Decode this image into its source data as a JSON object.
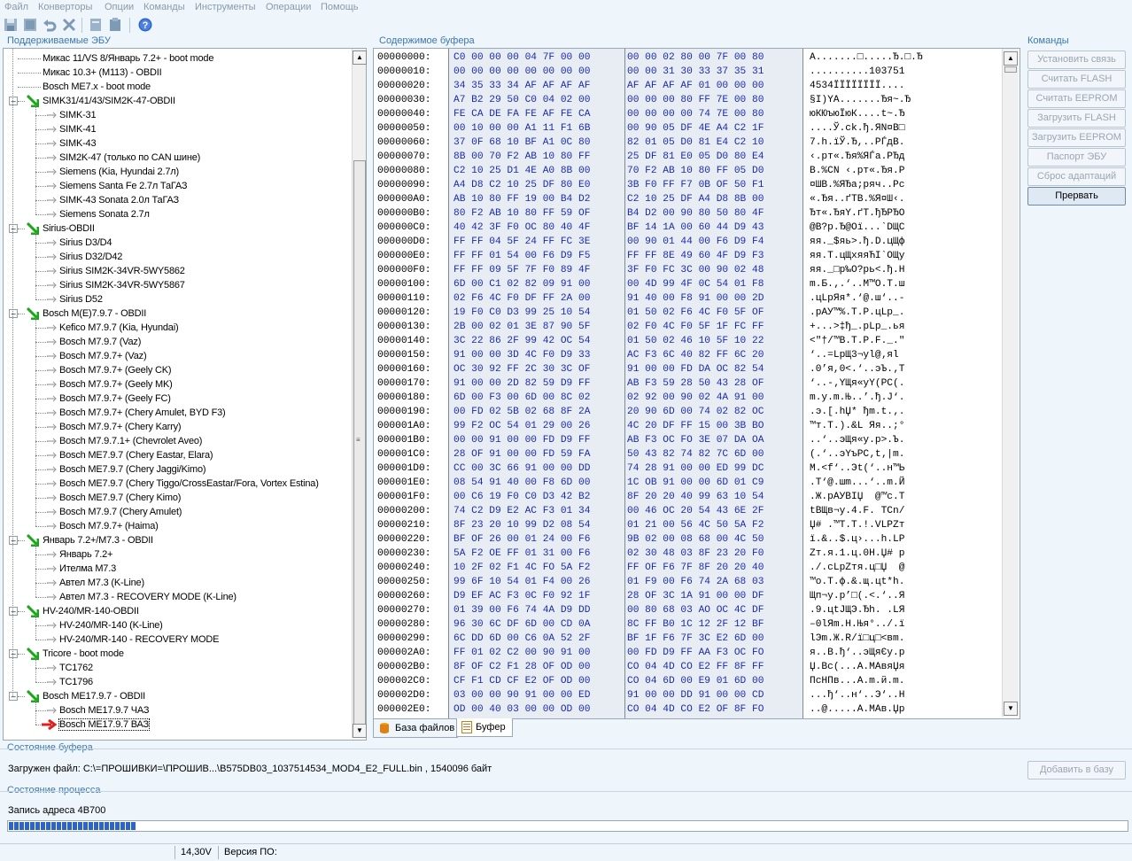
{
  "menu": [
    "Файл",
    "Конверторы",
    "Опции",
    "Команды",
    "Инструменты",
    "Операции",
    "Помощь"
  ],
  "toolbar_icons": [
    "save-icon",
    "save-all-icon",
    "undo-icon",
    "tools-icon",
    "copy-icon",
    "paste-icon",
    "help-icon"
  ],
  "sections": {
    "ecu": "Поддерживаемые ЭБУ",
    "buffer": "Содержимое буфера",
    "commands": "Команды",
    "buffer_state": "Состояние буфера",
    "process_state": "Состояние процесса"
  },
  "tree": [
    {
      "label": "Микас 11/VS 8/Январь 7.2+ - boot mode",
      "level": 1
    },
    {
      "label": "Микас 10.3+ (M113) - OBDII",
      "level": 1
    },
    {
      "label": "Bosch ME7.x - boot mode",
      "level": 1
    },
    {
      "label": "SIMK31/41/43/SIM2K-47-OBDII",
      "level": 0
    },
    {
      "label": "SIMK-31",
      "level": 2
    },
    {
      "label": "SIMK-41",
      "level": 2
    },
    {
      "label": "SIMK-43",
      "level": 2
    },
    {
      "label": "SIM2K-47 (только по CAN шине)",
      "level": 2
    },
    {
      "label": "Siemens (Kia, Hyundai 2.7л)",
      "level": 2
    },
    {
      "label": "Siemens Santa Fe 2.7л ТаГАЗ",
      "level": 2
    },
    {
      "label": "SIMK-43 Sonata 2.0л ТаГАЗ",
      "level": 2
    },
    {
      "label": "Siemens Sonata 2.7л",
      "level": 2
    },
    {
      "label": "Sirius-OBDII",
      "level": 0
    },
    {
      "label": "Sirius D3/D4",
      "level": 2
    },
    {
      "label": "Sirius D32/D42",
      "level": 2
    },
    {
      "label": "Sirius SIM2K-34VR-5WY5862",
      "level": 2
    },
    {
      "label": "Sirius SIM2K-34VR-5WY5867",
      "level": 2
    },
    {
      "label": "Sirius D52",
      "level": 2
    },
    {
      "label": "Bosch M(E)7.9.7 - OBDII",
      "level": 0
    },
    {
      "label": "Kefico M7.9.7 (Kia, Hyundai)",
      "level": 2
    },
    {
      "label": "Bosch M7.9.7 (Vaz)",
      "level": 2
    },
    {
      "label": "Bosch M7.9.7+ (Vaz)",
      "level": 2
    },
    {
      "label": "Bosch M7.9.7+ (Geely CK)",
      "level": 2
    },
    {
      "label": "Bosch M7.9.7+ (Geely MK)",
      "level": 2
    },
    {
      "label": "Bosch M7.9.7+ (Geely FC)",
      "level": 2
    },
    {
      "label": "Bosch M7.9.7+ (Chery Amulet, BYD F3)",
      "level": 2
    },
    {
      "label": "Bosch M7.9.7+ (Chery Karry)",
      "level": 2
    },
    {
      "label": "Bosch M7.9.7.1+ (Chevrolet Aveo)",
      "level": 2
    },
    {
      "label": "Bosch ME7.9.7 (Chery Eastar, Elara)",
      "level": 2
    },
    {
      "label": "Bosch ME7.9.7 (Chery Jaggi/Kimo)",
      "level": 2
    },
    {
      "label": "Bosch ME7.9.7 (Chery Tiggo/CrossEastar/Fora, Vortex Estina)",
      "level": 2
    },
    {
      "label": "Bosch ME7.9.7 (Chery Kimo)",
      "level": 2
    },
    {
      "label": "Bosch M7.9.7 (Chery Amulet)",
      "level": 2
    },
    {
      "label": "Bosch M7.9.7+ (Haima)",
      "level": 2
    },
    {
      "label": "Январь 7.2+/M7.3 - OBDII",
      "level": 0
    },
    {
      "label": "Январь 7.2+",
      "level": 2
    },
    {
      "label": "Ителма M7.3",
      "level": 2
    },
    {
      "label": "Автел M7.3  (K-Line)",
      "level": 2
    },
    {
      "label": "Автел M7.3 - RECOVERY MODE  (K-Line)",
      "level": 2
    },
    {
      "label": "HV-240/MR-140-OBDII",
      "level": 0
    },
    {
      "label": "HV-240/MR-140 (K-Line)",
      "level": 2
    },
    {
      "label": "HV-240/MR-140 - RECOVERY MODE",
      "level": 2
    },
    {
      "label": "Tricore - boot mode",
      "level": 0
    },
    {
      "label": "TC1762",
      "level": 2
    },
    {
      "label": "TC1796",
      "level": 2
    },
    {
      "label": "Bosch ME17.9.7 - OBDII",
      "level": 0
    },
    {
      "label": "Bosch ME17.9.7 ЧАЗ",
      "level": 2
    },
    {
      "label": "Bosch ME17.9.7 ВАЗ",
      "level": 2,
      "selected": true
    }
  ],
  "hex_rows": [
    [
      "00000000:",
      "C0 00 00 00 04 7F 00 00",
      "00 00 02 80 00 7F 00 80",
      "А.......□.....Ђ.□.Ђ"
    ],
    [
      "00000010:",
      "00 00 00 00 00 00 00 00",
      "00 00 31 30 33 37 35 31",
      "..........103751"
    ],
    [
      "00000020:",
      "34 35 33 34 AF AF AF AF",
      "AF AF AF AF 01 00 00 00",
      "4534ЇЇЇЇЇЇЇЇ...."
    ],
    [
      "00000030:",
      "A7 B2 29 50 C0 04 02 00",
      "00 00 00 80 FF 7E 00 80",
      "§І)YА.......Ђя~.Ђ"
    ],
    [
      "00000040:",
      "FE CA DE FA FE AF FE CA",
      "00 00 00 00 74 7E 00 80",
      "юКЮъюЇюК....t~.Ђ"
    ],
    [
      "00000050:",
      "00 10 00 00 A1 11 F1 6B",
      "00 90 05 DF 4E A4 C2 1F",
      "....Ў.ck.ђ.ЯN¤В□"
    ],
    [
      "00000060:",
      "37 0F 68 10 BF A1 0C 80",
      "82 01 05 D0 81 E4 C2 10",
      "7.h.їЎ.Ђ,..РЃдВ."
    ],
    [
      "00000070:",
      "8B 00 70 F2 AB 10 80 FF",
      "25 DF 81 E0 05 D0 80 E4",
      "‹.рт«.Ђя%ЯЃа.РЂд"
    ],
    [
      "00000080:",
      "C2 10 25 D1 4E A0 8B 00",
      "70 F2 AB 10 80 FF 05 D0",
      "В.%СN ‹.рт«.Ђя.Р"
    ],
    [
      "00000090:",
      "A4 D8 C2 10 25 DF 80 E0",
      "3B F0 FF F7 0B OF 50 F1",
      "¤ШВ.%ЯЂа;ряч..Pс"
    ],
    [
      "000000A0:",
      "AB 10 80 FF 19 00 B4 D2",
      "C2 10 25 DF A4 D8 8B 00",
      "«.Ђя..ґТВ.%Я¤Ш‹."
    ],
    [
      "000000B0:",
      "80 F2 AB 10 80 FF 59 OF",
      "B4 D2 00 90 80 50 80 4F",
      "Ђт«.ЂяY.ґТ.ђЂPЂO"
    ],
    [
      "000000C0:",
      "40 42 3F F0 OC 80 40 4F",
      "BF 14 1A 00 60 44 D9 43",
      "@B?р.Ђ@Oї...`DЩC"
    ],
    [
      "000000D0:",
      "FF FF 04 5F 24 FF FC 3E",
      "00 90 01 44 00 F6 D9 F4",
      "яя._$яь>.ђ.D.цЩф"
    ],
    [
      "000000E0:",
      "FF FF 01 54 00 F6 D9 F5",
      "FF FF 8E 49 60 4F D9 F3",
      "яя.T.цЩхяяЋI`OЩу"
    ],
    [
      "000000F0:",
      "FF FF 09 5F 7F F0 89 4F",
      "3F F0 FC 3C 00 90 02 48",
      "яя._□р‰O?рь<.ђ.H"
    ],
    [
      "00000100:",
      "6D 00 C1 02 82 09 91 00",
      "00 4D 99 4F 0C 54 01 F8",
      "m.Б.‚.‘..M™O.T.ш"
    ],
    [
      "00000110:",
      "02 F6 4C F0 DF FF 2A 00",
      "91 40 00 F8 91 00 00 2D",
      ".цLрЯя*.‘@.ш‘..-"
    ],
    [
      "00000120:",
      "19 F0 C0 D3 99 25 10 54",
      "01 50 02 F6 4C F0 5F OF",
      ".рАУ™%.T.P.цLр_."
    ],
    [
      "00000130:",
      "2B 00 02 01 3E 87 90 5F",
      "02 F0 4C F0 5F 1F FC FF",
      "+...>‡ђ_.рLр_.ья"
    ],
    [
      "00000140:",
      "3C 22 86 2F 99 42 OC 54",
      "01 50 02 46 10 5F 10 22",
      "<\"†/™B.T.P.F._.\""
    ],
    [
      "00000150:",
      "91 00 00 3D 4C F0 D9 33",
      "AC F3 6C 40 82 FF 6C 20",
      "‘..=LрЩ3¬уl@‚яl "
    ],
    [
      "00000160:",
      "OC 30 92 FF 2C 30 3C OF",
      "91 00 00 FD DA OC 82 54",
      ".0’я,0<.‘..эЪ.‚T"
    ],
    [
      "00000170:",
      "91 00 00 2D 82 59 D9 FF",
      "AB F3 59 28 50 43 28 OF",
      "‘..-‚YЩя«уY(PC(."
    ],
    [
      "00000180:",
      "6D 00 F3 00 6D 00 8C 02",
      "02 92 00 90 02 4A 91 00",
      "m.у.m.Њ..’.ђ.J‘."
    ],
    [
      "00000190:",
      "00 FD 02 5B 02 68 8F 2A",
      "20 90 6D 00 74 02 82 OC",
      ".э.[.hЏ* ђm.t.‚."
    ],
    [
      "000001A0:",
      "99 F2 OC 54 01 29 00 26",
      "4C 20 DF FF 15 00 3B BO",
      "™т.T.).&L Яя..;°"
    ],
    [
      "000001B0:",
      "00 00 91 00 00 FD D9 FF",
      "AB F3 OC FO 3E 07 DA OA",
      "..‘..эЩя«у.р>.Ъ."
    ],
    [
      "000001C0:",
      "28 OF 91 00 00 FD 59 FA",
      "50 43 82 74 82 7C 6D 00",
      "(.‘..эYъPC‚t‚|m."
    ],
    [
      "000001D0:",
      "CC 00 3C 66 91 00 00 DD",
      "74 28 91 00 00 ED 99 DC",
      "М.<f‘..Эt(‘..н™Ь"
    ],
    [
      "000001E0:",
      "08 54 91 40 00 F8 6D 00",
      "1C OB 91 00 00 6D 01 C9",
      ".T‘@.шm...‘..m.Й"
    ],
    [
      "000001F0:",
      "00 C6 19 F0 C0 D3 42 B2",
      "8F 20 20 40 99 63 10 54",
      ".Ж.рАУBІЏ  @™c.T"
    ],
    [
      "00000200:",
      "74 C2 D9 E2 AC F3 01 34",
      "00 46 OC 20 54 43 6E 2F",
      "tВЩв¬у.4.F. TCn/"
    ],
    [
      "00000210:",
      "8F 23 20 10 99 D2 08 54",
      "01 21 00 56 4C 50 5A F2",
      "Џ# .™Т.T.!.VLPZт"
    ],
    [
      "00000220:",
      "BF OF 26 00 01 24 00 F6",
      "9B 02 00 08 68 00 4C 50",
      "ї.&..$.ц›...h.LP"
    ],
    [
      "00000230:",
      "5A F2 OE FF 01 31 00 F6",
      "02 30 48 03 8F 23 20 F0",
      "Zт.я.1.ц.0H.Џ# р"
    ],
    [
      "00000240:",
      "10 2F 02 F1 4C FO 5A F2",
      "FF OF F6 7F 8F 20 20 40",
      "./.сLрZтя.ц□Џ  @"
    ],
    [
      "00000250:",
      "99 6F 10 54 01 F4 00 26",
      "01 F9 00 F6 74 2A 68 03",
      "™o.T.ф.&.щ.цt*h."
    ],
    [
      "00000260:",
      "D9 EF AC F3 0C F0 92 1F",
      "28 OF 3C 1A 91 00 00 DF",
      "Щп¬у.р’□(.<.‘..Я"
    ],
    [
      "00000270:",
      "01 39 00 F6 74 4A D9 DD",
      "00 80 68 03 AO OC 4C DF",
      ".9.цtJЩЭ.Ђh. .LЯ"
    ],
    [
      "00000280:",
      "96 30 6C DF 6D 00 CD 0A",
      "8C FF B0 1C 12 2F 12 BF",
      "–0lЯm.Н.Њя°../.ї"
    ],
    [
      "00000290:",
      "6C DD 6D 00 C6 0A 52 2F",
      "BF 1F F6 7F 3C E2 6D 00",
      "lЭm.Ж.R/ї□ц□<вm."
    ],
    [
      "000002A0:",
      "FF 01 02 C2 00 90 91 00",
      "00 FD D9 FF AA F3 OC FO",
      "я..В.ђ‘..эЩяЄу.р"
    ],
    [
      "000002B0:",
      "8F OF C2 F1 28 OF OD 00",
      "CO 04 4D CO E2 FF 8F FF",
      "Џ.Вс(...А.MАвяЏя"
    ],
    [
      "000002C0:",
      "CF F1 CD CF E2 OF OD 00",
      "CO 04 6D 00 E9 01 6D 00",
      "ПсНПв...А.m.й.m."
    ],
    [
      "000002D0:",
      "03 00 00 90 91 00 00 ED",
      "91 00 00 DD 91 00 00 CD",
      "...ђ‘..н‘..Э‘..Н"
    ],
    [
      "000002E0:",
      "OD 00 40 03 00 00 OD 00",
      "CO 04 4D CO E2 OF 8F FO",
      "..@.....А.MАв.Џр"
    ]
  ],
  "tabs": [
    "База файлов",
    "Буфер"
  ],
  "commands": [
    {
      "label": "Установить связь",
      "enabled": false
    },
    {
      "label": "Считать FLASH",
      "enabled": false
    },
    {
      "label": "Считать EEPROM",
      "enabled": false
    },
    {
      "label": "Загрузить FLASH",
      "enabled": false
    },
    {
      "label": "Загрузить EEPROM",
      "enabled": false
    },
    {
      "label": "Паспорт ЭБУ",
      "enabled": false
    },
    {
      "label": "Сброс адаптаций",
      "enabled": false
    },
    {
      "label": "Прервать",
      "enabled": true
    }
  ],
  "buffer_status": "Загружен файл: C:\\=ПРОШИВКИ=\\ПРОШИВ...\\B575DB03_1037514534_MOD4_E2_FULL.bin , 1540096 байт",
  "add_to_db": "Добавить в базу",
  "process_status": "Запись адреса 4B700",
  "progress_percent": 11.3,
  "statusbar": {
    "voltage": "14,30V",
    "version": "Версия ПО:"
  }
}
